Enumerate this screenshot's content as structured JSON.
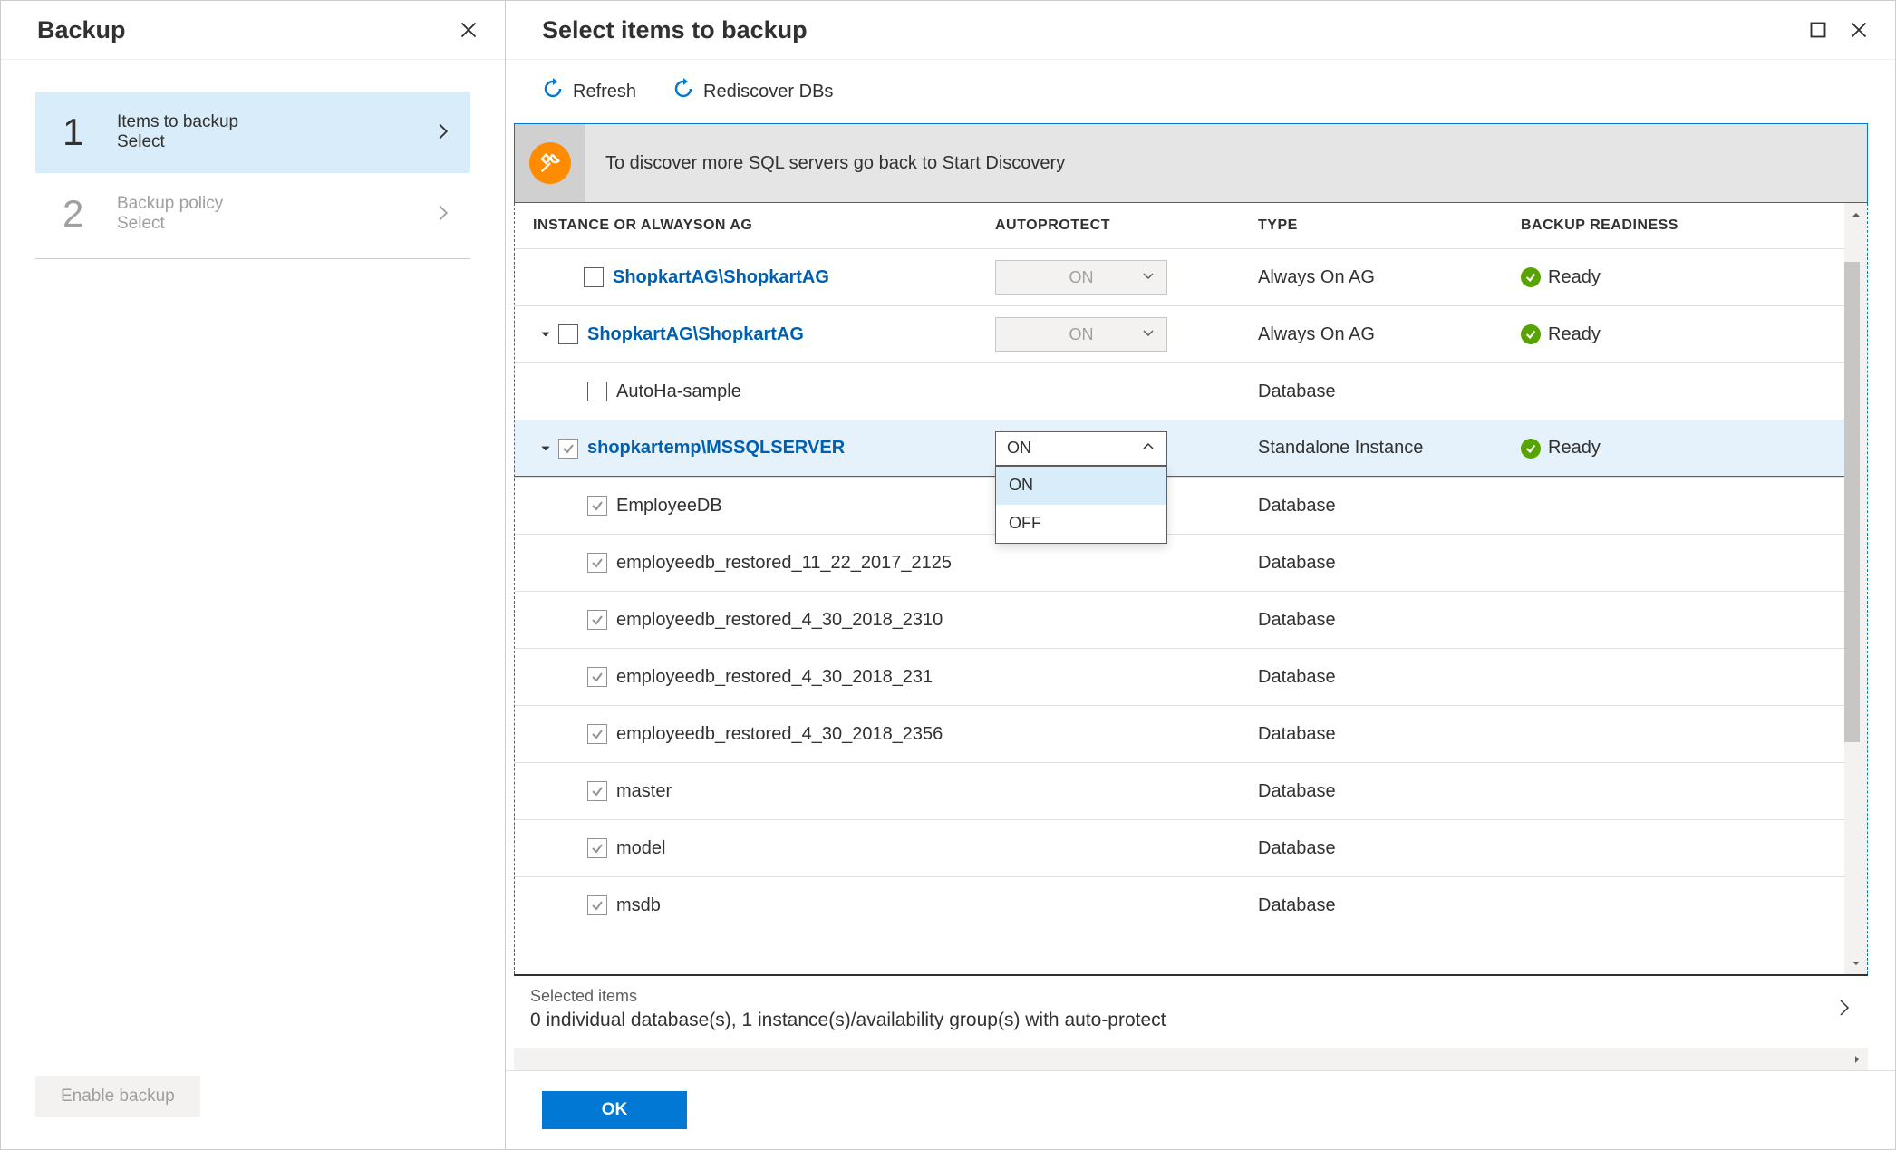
{
  "leftPanel": {
    "title": "Backup",
    "steps": [
      {
        "num": "1",
        "label": "Items to backup",
        "sub": "Select",
        "active": true
      },
      {
        "num": "2",
        "label": "Backup policy",
        "sub": "Select",
        "active": false
      }
    ],
    "enableBackup": "Enable backup"
  },
  "rightPanel": {
    "title": "Select items to backup",
    "toolbar": {
      "refresh": "Refresh",
      "rediscover": "Rediscover DBs"
    },
    "banner": "To discover more SQL servers go back to Start Discovery",
    "columns": {
      "instance": "INSTANCE OR ALWAYSON AG",
      "autoprotect": "AUTOPROTECT",
      "type": "TYPE",
      "readiness": "BACKUP READINESS"
    },
    "readyLabel": "Ready",
    "autoprotectOptions": {
      "on": "ON",
      "off": "OFF"
    },
    "rows": [
      {
        "name": "ShopkartAG\\ShopkartAG",
        "link": true,
        "indent": 1,
        "expander": "none",
        "checked": false,
        "autoprotect": "ON",
        "autoEnabled": false,
        "type": "Always On AG",
        "ready": true
      },
      {
        "name": "ShopkartAG\\ShopkartAG",
        "link": true,
        "indent": 0,
        "expander": "open",
        "checked": false,
        "autoprotect": "ON",
        "autoEnabled": false,
        "type": "Always On AG",
        "ready": true
      },
      {
        "name": "AutoHa-sample",
        "link": false,
        "indent": 2,
        "expander": "none",
        "checked": false,
        "autoprotect": null,
        "type": "Database",
        "ready": false
      },
      {
        "name": "shopkartemp\\MSSQLSERVER",
        "link": true,
        "indent": 0,
        "expander": "open",
        "checked": true,
        "autoprotect": "ON",
        "autoEnabled": true,
        "dropdownOpen": true,
        "type": "Standalone Instance",
        "ready": true,
        "selected": true
      },
      {
        "name": "EmployeeDB",
        "link": false,
        "indent": 2,
        "expander": "none",
        "checked": true,
        "autoprotect": null,
        "type": "Database",
        "ready": false
      },
      {
        "name": "employeedb_restored_11_22_2017_2125",
        "link": false,
        "indent": 2,
        "expander": "none",
        "checked": true,
        "autoprotect": null,
        "type": "Database",
        "ready": false
      },
      {
        "name": "employeedb_restored_4_30_2018_2310",
        "link": false,
        "indent": 2,
        "expander": "none",
        "checked": true,
        "autoprotect": null,
        "type": "Database",
        "ready": false
      },
      {
        "name": "employeedb_restored_4_30_2018_231",
        "link": false,
        "indent": 2,
        "expander": "none",
        "checked": true,
        "autoprotect": null,
        "type": "Database",
        "ready": false
      },
      {
        "name": "employeedb_restored_4_30_2018_2356",
        "link": false,
        "indent": 2,
        "expander": "none",
        "checked": true,
        "autoprotect": null,
        "type": "Database",
        "ready": false
      },
      {
        "name": "master",
        "link": false,
        "indent": 2,
        "expander": "none",
        "checked": true,
        "autoprotect": null,
        "type": "Database",
        "ready": false
      },
      {
        "name": "model",
        "link": false,
        "indent": 2,
        "expander": "none",
        "checked": true,
        "autoprotect": null,
        "type": "Database",
        "ready": false
      },
      {
        "name": "msdb",
        "link": false,
        "indent": 2,
        "expander": "none",
        "checked": true,
        "autoprotect": null,
        "type": "Database",
        "ready": false
      }
    ],
    "summary": {
      "header": "Selected items",
      "body": "0 individual database(s), 1 instance(s)/availability group(s) with auto-protect"
    },
    "okButton": "OK"
  }
}
